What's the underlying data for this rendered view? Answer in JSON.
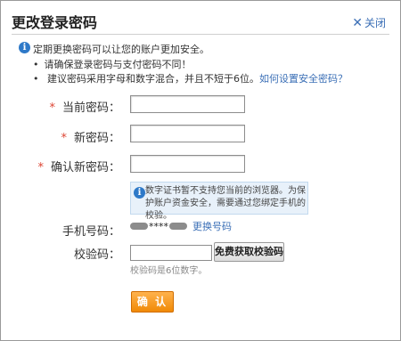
{
  "dialog": {
    "title": "更改登录密码",
    "close_label": "关闭"
  },
  "tips": {
    "main": "定期更换密码可以让您的账户更加安全。",
    "bullet1": "请确保登录密码与支付密码不同！",
    "bullet2_text": "建议密码采用字母和数字混合，并且不短于6位。",
    "bullet2_link": "如何设置安全密码？"
  },
  "form": {
    "required_mark": "*",
    "current_password_label": "当前密码：",
    "new_password_label": "新密码：",
    "confirm_password_label": "确认新密码：",
    "notice_text": "数字证书暂不支持您当前的浏览器。为保护账户资金安全，需要通过您绑定手机的校验。",
    "phone_label": "手机号码：",
    "phone_masked": "****",
    "change_phone_link": "更换号码",
    "code_label": "校验码：",
    "get_code_button": "免费获取校验码",
    "code_hint": "校验码是6位数字。",
    "confirm_button": "确 认"
  },
  "colors": {
    "link": "#3b6fb6",
    "required": "#dd4433",
    "confirm_button": "#f08a06",
    "info_icon": "#2e79c8"
  }
}
